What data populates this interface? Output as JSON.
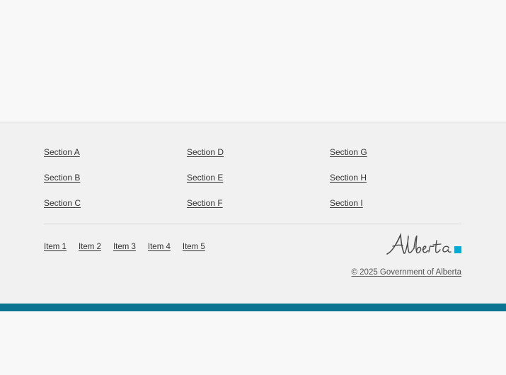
{
  "footer": {
    "sections": [
      [
        "Section A",
        "Section B",
        "Section C"
      ],
      [
        "Section D",
        "Section E",
        "Section F"
      ],
      [
        "Section G",
        "Section H",
        "Section I"
      ]
    ],
    "items": [
      "Item 1",
      "Item 2",
      "Item 3",
      "Item 4",
      "Item 5"
    ],
    "logo": {
      "text": "Alberta",
      "accent_color": "#00aad2"
    },
    "copyright": "© 2025 Government of Alberta"
  },
  "colors": {
    "footer_bg": "#f1f1f1",
    "page_bg": "#f8f8f8",
    "bottom_bar": "#0c7493",
    "link_text": "#333333"
  }
}
